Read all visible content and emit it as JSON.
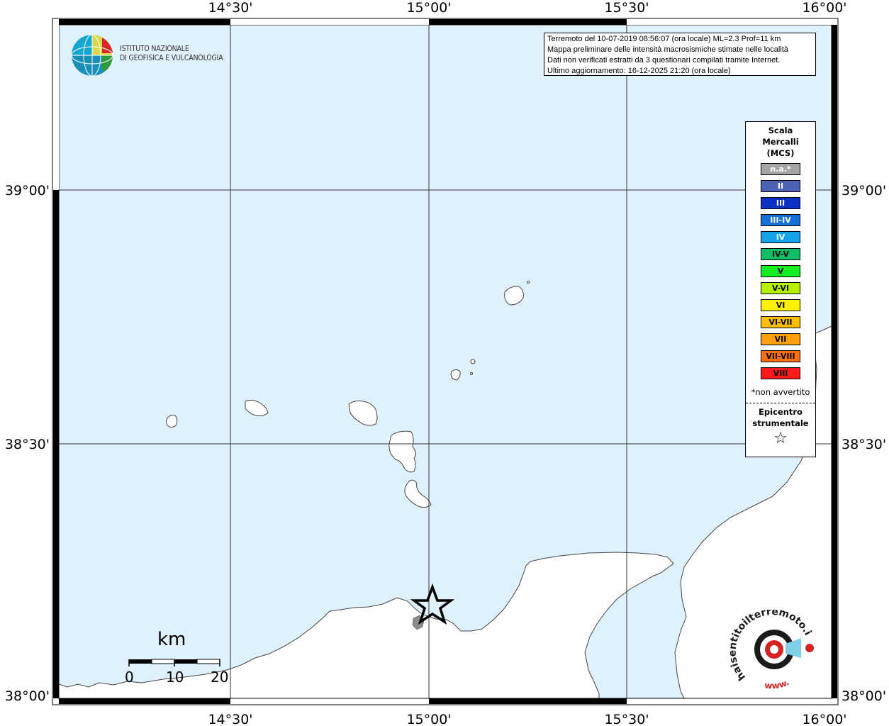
{
  "map": {
    "lon_ticks_top": [
      "14°30'",
      "15°00'",
      "15°30'",
      "16°00'"
    ],
    "lon_ticks_bottom": [
      "14°30'",
      "15°00'",
      "15°30'",
      "16°00'"
    ],
    "lat_ticks_left": [
      "39°00'",
      "38°30'",
      "38°00'"
    ],
    "lat_ticks_right": [
      "39°00'",
      "38°30'",
      "38°00'"
    ],
    "sea_color": "#dff1fd",
    "land_color": "#ffffff"
  },
  "logo": {
    "line1": "ISTITUTO NAZIONALE",
    "line2": "DI GEOFISICA E VULCANOLOGIA"
  },
  "info": {
    "line1": "Terremoto del 10-07-2019 08:56:07 (ora locale) ML=2.3 Prof=11 km",
    "line2": "Mappa preliminare delle intensità macrosismiche stimate nelle località",
    "line3": "Dati non verificati estratti da 3 questionari compilati tramite Internet.",
    "line4": "Ultimo aggiornamento: 16-12-2025 21:20 (ora locale)"
  },
  "legend": {
    "title1": "Scala",
    "title2": "Mercalli",
    "title3": "(MCS)",
    "items": [
      {
        "label": "n.a.*",
        "color": "#a5a5a5",
        "text": "#ffffff"
      },
      {
        "label": "II",
        "color": "#4c63b4",
        "text": "#ffffff"
      },
      {
        "label": "III",
        "color": "#0b31c4",
        "text": "#ffffff"
      },
      {
        "label": "III-IV",
        "color": "#1570d8",
        "text": "#ffffff"
      },
      {
        "label": "IV",
        "color": "#15a2e8",
        "text": "#ffffff"
      },
      {
        "label": "IV-V",
        "color": "#0fbe65",
        "text": "#000000"
      },
      {
        "label": "V",
        "color": "#12ee20",
        "text": "#000000"
      },
      {
        "label": "V-VI",
        "color": "#b6f000",
        "text": "#000000"
      },
      {
        "label": "VI",
        "color": "#fff20a",
        "text": "#000000"
      },
      {
        "label": "VI-VII",
        "color": "#ffc000",
        "text": "#000000"
      },
      {
        "label": "VII",
        "color": "#ffa008",
        "text": "#000000"
      },
      {
        "label": "VII-VIII",
        "color": "#fc7012",
        "text": "#000000"
      },
      {
        "label": "VIII",
        "color": "#ff1a1a",
        "text": "#000000"
      }
    ],
    "note": "*non avvertito",
    "epi1": "Epicentro",
    "epi2": "strumentale",
    "star": "☆"
  },
  "scalebar": {
    "unit": "km",
    "labels": [
      "0",
      "10",
      "20"
    ]
  },
  "hst": {
    "main": "haisentitoilterremoto.it",
    "www": "www."
  }
}
